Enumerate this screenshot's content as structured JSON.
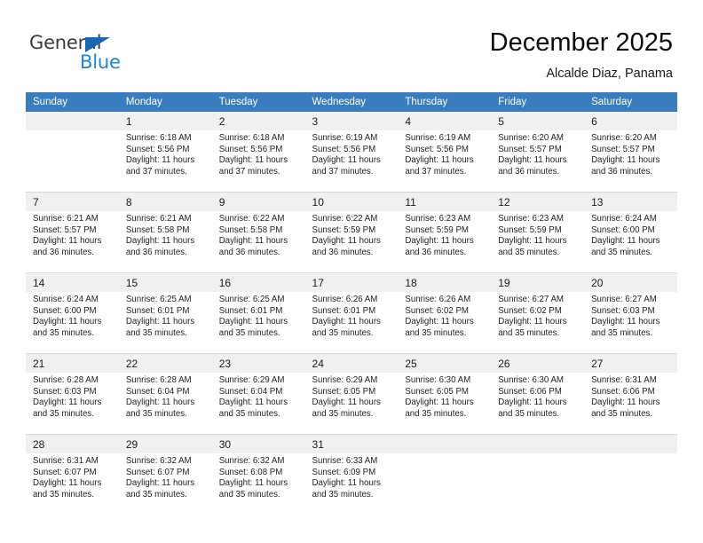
{
  "brand": {
    "name_part1": "General",
    "name_part2": "Blue",
    "triangle_color": "#1668b3",
    "blue_color": "#1f85d0"
  },
  "header": {
    "title": "December 2025",
    "subtitle": "Alcalde Diaz, Panama",
    "header_bg": "#3a7dbf"
  },
  "weekdays": [
    "Sunday",
    "Monday",
    "Tuesday",
    "Wednesday",
    "Thursday",
    "Friday",
    "Saturday"
  ],
  "weeks": [
    [
      {
        "day": "",
        "sunrise": "",
        "sunset": "",
        "daylight1": "",
        "daylight2": ""
      },
      {
        "day": "1",
        "sunrise": "Sunrise: 6:18 AM",
        "sunset": "Sunset: 5:56 PM",
        "daylight1": "Daylight: 11 hours",
        "daylight2": "and 37 minutes."
      },
      {
        "day": "2",
        "sunrise": "Sunrise: 6:18 AM",
        "sunset": "Sunset: 5:56 PM",
        "daylight1": "Daylight: 11 hours",
        "daylight2": "and 37 minutes."
      },
      {
        "day": "3",
        "sunrise": "Sunrise: 6:19 AM",
        "sunset": "Sunset: 5:56 PM",
        "daylight1": "Daylight: 11 hours",
        "daylight2": "and 37 minutes."
      },
      {
        "day": "4",
        "sunrise": "Sunrise: 6:19 AM",
        "sunset": "Sunset: 5:56 PM",
        "daylight1": "Daylight: 11 hours",
        "daylight2": "and 37 minutes."
      },
      {
        "day": "5",
        "sunrise": "Sunrise: 6:20 AM",
        "sunset": "Sunset: 5:57 PM",
        "daylight1": "Daylight: 11 hours",
        "daylight2": "and 36 minutes."
      },
      {
        "day": "6",
        "sunrise": "Sunrise: 6:20 AM",
        "sunset": "Sunset: 5:57 PM",
        "daylight1": "Daylight: 11 hours",
        "daylight2": "and 36 minutes."
      }
    ],
    [
      {
        "day": "7",
        "sunrise": "Sunrise: 6:21 AM",
        "sunset": "Sunset: 5:57 PM",
        "daylight1": "Daylight: 11 hours",
        "daylight2": "and 36 minutes."
      },
      {
        "day": "8",
        "sunrise": "Sunrise: 6:21 AM",
        "sunset": "Sunset: 5:58 PM",
        "daylight1": "Daylight: 11 hours",
        "daylight2": "and 36 minutes."
      },
      {
        "day": "9",
        "sunrise": "Sunrise: 6:22 AM",
        "sunset": "Sunset: 5:58 PM",
        "daylight1": "Daylight: 11 hours",
        "daylight2": "and 36 minutes."
      },
      {
        "day": "10",
        "sunrise": "Sunrise: 6:22 AM",
        "sunset": "Sunset: 5:59 PM",
        "daylight1": "Daylight: 11 hours",
        "daylight2": "and 36 minutes."
      },
      {
        "day": "11",
        "sunrise": "Sunrise: 6:23 AM",
        "sunset": "Sunset: 5:59 PM",
        "daylight1": "Daylight: 11 hours",
        "daylight2": "and 36 minutes."
      },
      {
        "day": "12",
        "sunrise": "Sunrise: 6:23 AM",
        "sunset": "Sunset: 5:59 PM",
        "daylight1": "Daylight: 11 hours",
        "daylight2": "and 35 minutes."
      },
      {
        "day": "13",
        "sunrise": "Sunrise: 6:24 AM",
        "sunset": "Sunset: 6:00 PM",
        "daylight1": "Daylight: 11 hours",
        "daylight2": "and 35 minutes."
      }
    ],
    [
      {
        "day": "14",
        "sunrise": "Sunrise: 6:24 AM",
        "sunset": "Sunset: 6:00 PM",
        "daylight1": "Daylight: 11 hours",
        "daylight2": "and 35 minutes."
      },
      {
        "day": "15",
        "sunrise": "Sunrise: 6:25 AM",
        "sunset": "Sunset: 6:01 PM",
        "daylight1": "Daylight: 11 hours",
        "daylight2": "and 35 minutes."
      },
      {
        "day": "16",
        "sunrise": "Sunrise: 6:25 AM",
        "sunset": "Sunset: 6:01 PM",
        "daylight1": "Daylight: 11 hours",
        "daylight2": "and 35 minutes."
      },
      {
        "day": "17",
        "sunrise": "Sunrise: 6:26 AM",
        "sunset": "Sunset: 6:01 PM",
        "daylight1": "Daylight: 11 hours",
        "daylight2": "and 35 minutes."
      },
      {
        "day": "18",
        "sunrise": "Sunrise: 6:26 AM",
        "sunset": "Sunset: 6:02 PM",
        "daylight1": "Daylight: 11 hours",
        "daylight2": "and 35 minutes."
      },
      {
        "day": "19",
        "sunrise": "Sunrise: 6:27 AM",
        "sunset": "Sunset: 6:02 PM",
        "daylight1": "Daylight: 11 hours",
        "daylight2": "and 35 minutes."
      },
      {
        "day": "20",
        "sunrise": "Sunrise: 6:27 AM",
        "sunset": "Sunset: 6:03 PM",
        "daylight1": "Daylight: 11 hours",
        "daylight2": "and 35 minutes."
      }
    ],
    [
      {
        "day": "21",
        "sunrise": "Sunrise: 6:28 AM",
        "sunset": "Sunset: 6:03 PM",
        "daylight1": "Daylight: 11 hours",
        "daylight2": "and 35 minutes."
      },
      {
        "day": "22",
        "sunrise": "Sunrise: 6:28 AM",
        "sunset": "Sunset: 6:04 PM",
        "daylight1": "Daylight: 11 hours",
        "daylight2": "and 35 minutes."
      },
      {
        "day": "23",
        "sunrise": "Sunrise: 6:29 AM",
        "sunset": "Sunset: 6:04 PM",
        "daylight1": "Daylight: 11 hours",
        "daylight2": "and 35 minutes."
      },
      {
        "day": "24",
        "sunrise": "Sunrise: 6:29 AM",
        "sunset": "Sunset: 6:05 PM",
        "daylight1": "Daylight: 11 hours",
        "daylight2": "and 35 minutes."
      },
      {
        "day": "25",
        "sunrise": "Sunrise: 6:30 AM",
        "sunset": "Sunset: 6:05 PM",
        "daylight1": "Daylight: 11 hours",
        "daylight2": "and 35 minutes."
      },
      {
        "day": "26",
        "sunrise": "Sunrise: 6:30 AM",
        "sunset": "Sunset: 6:06 PM",
        "daylight1": "Daylight: 11 hours",
        "daylight2": "and 35 minutes."
      },
      {
        "day": "27",
        "sunrise": "Sunrise: 6:31 AM",
        "sunset": "Sunset: 6:06 PM",
        "daylight1": "Daylight: 11 hours",
        "daylight2": "and 35 minutes."
      }
    ],
    [
      {
        "day": "28",
        "sunrise": "Sunrise: 6:31 AM",
        "sunset": "Sunset: 6:07 PM",
        "daylight1": "Daylight: 11 hours",
        "daylight2": "and 35 minutes."
      },
      {
        "day": "29",
        "sunrise": "Sunrise: 6:32 AM",
        "sunset": "Sunset: 6:07 PM",
        "daylight1": "Daylight: 11 hours",
        "daylight2": "and 35 minutes."
      },
      {
        "day": "30",
        "sunrise": "Sunrise: 6:32 AM",
        "sunset": "Sunset: 6:08 PM",
        "daylight1": "Daylight: 11 hours",
        "daylight2": "and 35 minutes."
      },
      {
        "day": "31",
        "sunrise": "Sunrise: 6:33 AM",
        "sunset": "Sunset: 6:09 PM",
        "daylight1": "Daylight: 11 hours",
        "daylight2": "and 35 minutes."
      },
      {
        "day": "",
        "sunrise": "",
        "sunset": "",
        "daylight1": "",
        "daylight2": ""
      },
      {
        "day": "",
        "sunrise": "",
        "sunset": "",
        "daylight1": "",
        "daylight2": ""
      },
      {
        "day": "",
        "sunrise": "",
        "sunset": "",
        "daylight1": "",
        "daylight2": ""
      }
    ]
  ]
}
